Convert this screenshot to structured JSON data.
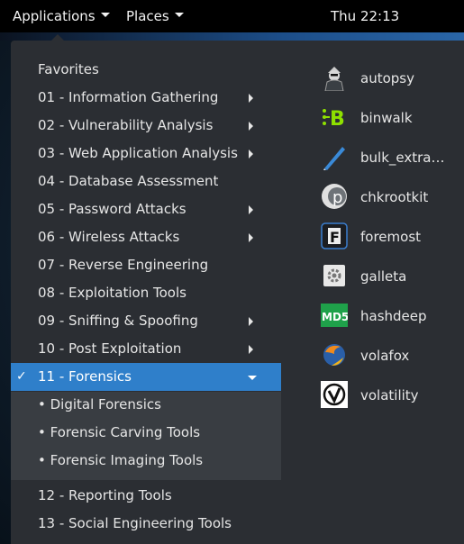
{
  "topbar": {
    "applications_label": "Applications",
    "places_label": "Places",
    "clock": "Thu 22:13"
  },
  "categories": [
    {
      "label": "Favorites",
      "has_submenu": false
    },
    {
      "label": "01 - Information Gathering",
      "has_submenu": true
    },
    {
      "label": "02 - Vulnerability Analysis",
      "has_submenu": true
    },
    {
      "label": "03 - Web Application Analysis",
      "has_submenu": true
    },
    {
      "label": "04 - Database Assessment",
      "has_submenu": false
    },
    {
      "label": "05 - Password Attacks",
      "has_submenu": true
    },
    {
      "label": "06 - Wireless Attacks",
      "has_submenu": true
    },
    {
      "label": "07 - Reverse Engineering",
      "has_submenu": false
    },
    {
      "label": "08 - Exploitation Tools",
      "has_submenu": false
    },
    {
      "label": "09 - Sniffing & Spoofing",
      "has_submenu": true
    },
    {
      "label": "10 - Post Exploitation",
      "has_submenu": true
    },
    {
      "label": "11 - Forensics",
      "has_submenu": true,
      "selected": true,
      "check": "✓"
    }
  ],
  "subcategories": [
    {
      "label": "• Digital Forensics"
    },
    {
      "label": "• Forensic Carving Tools"
    },
    {
      "label": "• Forensic Imaging Tools"
    }
  ],
  "more_categories": [
    {
      "label": "12 - Reporting Tools"
    },
    {
      "label": "13 - Social Engineering Tools"
    }
  ],
  "apps": [
    {
      "name": "autopsy",
      "icon": "autopsy-icon"
    },
    {
      "name": "binwalk",
      "icon": "binwalk-icon"
    },
    {
      "name": "bulk_extra…",
      "icon": "bulk-extractor-icon"
    },
    {
      "name": "chkrootkit",
      "icon": "chkrootkit-icon"
    },
    {
      "name": "foremost",
      "icon": "foremost-icon"
    },
    {
      "name": "galleta",
      "icon": "galleta-icon"
    },
    {
      "name": "hashdeep",
      "icon": "hashdeep-icon"
    },
    {
      "name": "volafox",
      "icon": "volafox-icon"
    },
    {
      "name": "volatility",
      "icon": "volatility-icon"
    }
  ],
  "icon_text": {
    "binwalk": "B",
    "chkrootkit": "p",
    "foremost": "F",
    "hashdeep": "MD5"
  },
  "colors": {
    "selected_bg": "#2f7fca",
    "menu_bg": "#2b2e33",
    "submenu_bg": "#393d42"
  }
}
